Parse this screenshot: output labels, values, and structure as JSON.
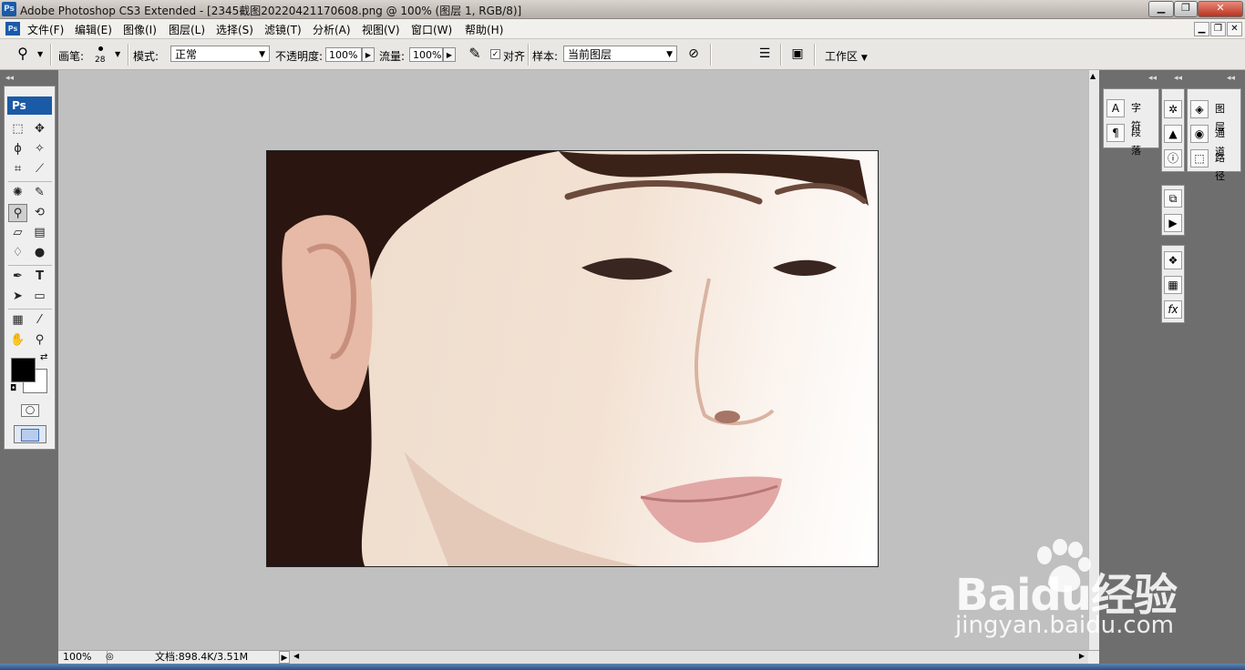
{
  "window": {
    "app_icon": "Ps",
    "title": "Adobe Photoshop CS3 Extended - [2345截图20220421170608.png @ 100% (图层 1, RGB/8)]",
    "minimize": "▁",
    "restore": "❐",
    "close": "✕"
  },
  "menu": {
    "items": [
      "文件(F)",
      "编辑(E)",
      "图像(I)",
      "图层(L)",
      "选择(S)",
      "滤镜(T)",
      "分析(A)",
      "视图(V)",
      "窗口(W)",
      "帮助(H)"
    ],
    "doc_controls": [
      "▁",
      "❐",
      "✕"
    ]
  },
  "options": {
    "brush_label": "画笔:",
    "brush_size": "28",
    "mode_label": "模式:",
    "mode_value": "正常",
    "opacity_label": "不透明度:",
    "opacity_value": "100%",
    "flow_label": "流量:",
    "flow_value": "100%",
    "align_label": "对齐",
    "align_checked": true,
    "sample_label": "样本:",
    "sample_value": "当前图层",
    "workspace_label": "工作区"
  },
  "toolbox": {
    "logo": "Ps",
    "foreground_color": "#000000",
    "background_color": "#ffffff"
  },
  "status": {
    "zoom": "100%",
    "doc_info": "文档:898.4K/3.51M"
  },
  "panels": {
    "group1": [
      "字符",
      "段落"
    ],
    "group3": [
      "图层",
      "通道",
      "路径"
    ]
  },
  "watermark": {
    "brand": "Baidu经验",
    "url": "jingyan.baidu.com"
  }
}
